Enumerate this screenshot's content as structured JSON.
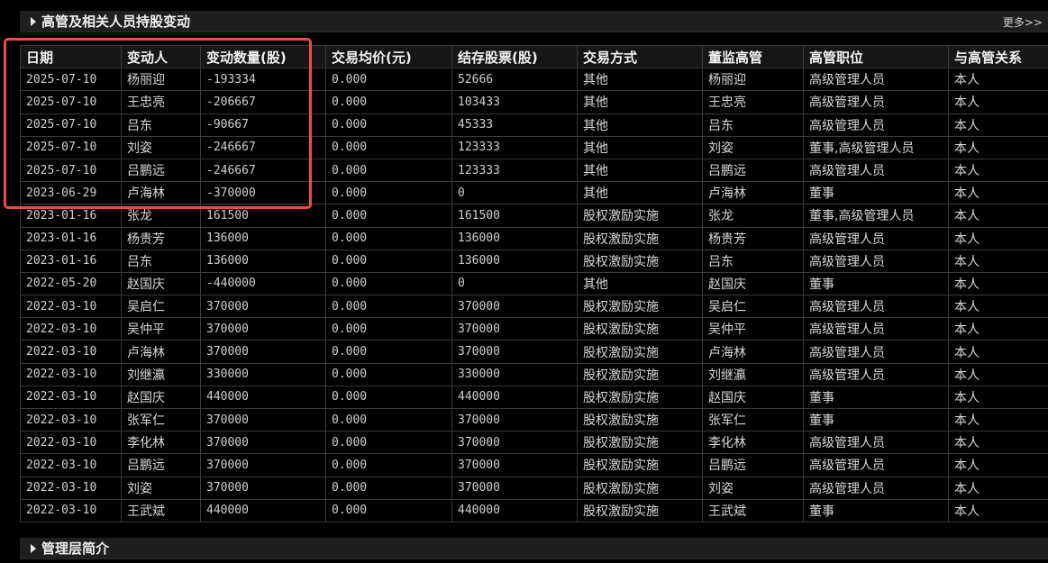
{
  "section": {
    "title": "高管及相关人员持股变动",
    "more_label": "更多>>"
  },
  "bottom_section": {
    "title": "管理层简介"
  },
  "columns": [
    "日期",
    "变动人",
    "变动数量(股)",
    "交易均价(元)",
    "结存股票(股)",
    "交易方式",
    "董监高管",
    "高管职位",
    "与高管关系"
  ],
  "rows": [
    [
      "2025-07-10",
      "杨丽迎",
      "-193334",
      "0.000",
      "52666",
      "其他",
      "杨丽迎",
      "高级管理人员",
      "本人"
    ],
    [
      "2025-07-10",
      "王忠亮",
      "-206667",
      "0.000",
      "103433",
      "其他",
      "王忠亮",
      "高级管理人员",
      "本人"
    ],
    [
      "2025-07-10",
      "吕东",
      "-90667",
      "0.000",
      "45333",
      "其他",
      "吕东",
      "高级管理人员",
      "本人"
    ],
    [
      "2025-07-10",
      "刘姿",
      "-246667",
      "0.000",
      "123333",
      "其他",
      "刘姿",
      "董事,高级管理人员",
      "本人"
    ],
    [
      "2025-07-10",
      "吕鹏远",
      "-246667",
      "0.000",
      "123333",
      "其他",
      "吕鹏远",
      "高级管理人员",
      "本人"
    ],
    [
      "2023-06-29",
      "卢海林",
      "-370000",
      "0.000",
      "0",
      "其他",
      "卢海林",
      "董事",
      "本人"
    ],
    [
      "2023-01-16",
      "张龙",
      "161500",
      "0.000",
      "161500",
      "股权激励实施",
      "张龙",
      "董事,高级管理人员",
      "本人"
    ],
    [
      "2023-01-16",
      "杨贵芳",
      "136000",
      "0.000",
      "136000",
      "股权激励实施",
      "杨贵芳",
      "高级管理人员",
      "本人"
    ],
    [
      "2023-01-16",
      "吕东",
      "136000",
      "0.000",
      "136000",
      "股权激励实施",
      "吕东",
      "高级管理人员",
      "本人"
    ],
    [
      "2022-05-20",
      "赵国庆",
      "-440000",
      "0.000",
      "0",
      "其他",
      "赵国庆",
      "董事",
      "本人"
    ],
    [
      "2022-03-10",
      "吴启仁",
      "370000",
      "0.000",
      "370000",
      "股权激励实施",
      "吴启仁",
      "高级管理人员",
      "本人"
    ],
    [
      "2022-03-10",
      "吴仲平",
      "370000",
      "0.000",
      "370000",
      "股权激励实施",
      "吴仲平",
      "高级管理人员",
      "本人"
    ],
    [
      "2022-03-10",
      "卢海林",
      "370000",
      "0.000",
      "370000",
      "股权激励实施",
      "卢海林",
      "高级管理人员",
      "本人"
    ],
    [
      "2022-03-10",
      "刘继瀛",
      "330000",
      "0.000",
      "330000",
      "股权激励实施",
      "刘继瀛",
      "高级管理人员",
      "本人"
    ],
    [
      "2022-03-10",
      "赵国庆",
      "440000",
      "0.000",
      "440000",
      "股权激励实施",
      "赵国庆",
      "董事",
      "本人"
    ],
    [
      "2022-03-10",
      "张军仁",
      "370000",
      "0.000",
      "370000",
      "股权激励实施",
      "张军仁",
      "董事",
      "本人"
    ],
    [
      "2022-03-10",
      "李化林",
      "370000",
      "0.000",
      "370000",
      "股权激励实施",
      "李化林",
      "高级管理人员",
      "本人"
    ],
    [
      "2022-03-10",
      "吕鹏远",
      "370000",
      "0.000",
      "370000",
      "股权激励实施",
      "吕鹏远",
      "高级管理人员",
      "本人"
    ],
    [
      "2022-03-10",
      "刘姿",
      "370000",
      "0.000",
      "370000",
      "股权激励实施",
      "刘姿",
      "高级管理人员",
      "本人"
    ],
    [
      "2022-03-10",
      "王武斌",
      "440000",
      "0.000",
      "440000",
      "股权激励实施",
      "王武斌",
      "董事",
      "本人"
    ]
  ],
  "colors": {
    "background": "#000000",
    "header_bar": "#1f1f1f",
    "grid_line": "#3a3a3a",
    "highlight": "#ee4b4b"
  }
}
